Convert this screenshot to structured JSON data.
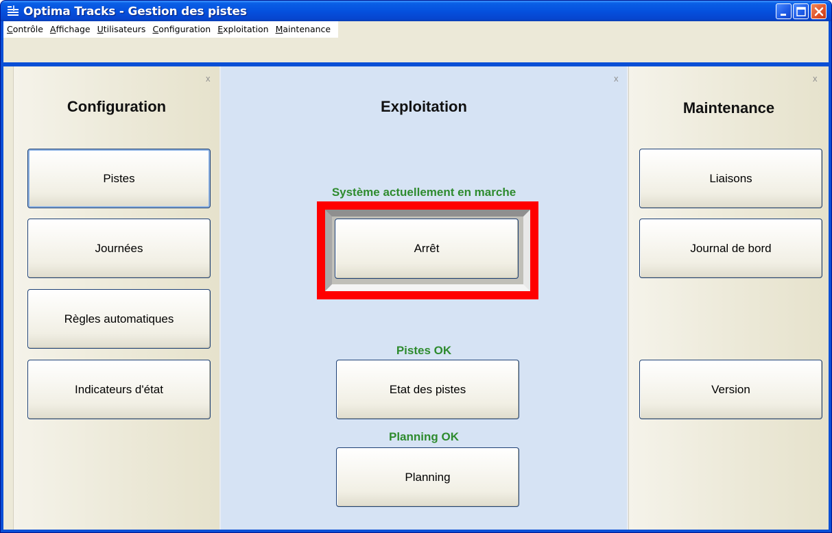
{
  "window": {
    "title": "Optima Tracks - Gestion des pistes"
  },
  "menu": {
    "items": [
      {
        "first": "C",
        "rest": "ontrôle"
      },
      {
        "first": "A",
        "rest": "ffichage"
      },
      {
        "first": "U",
        "rest": "tilisateurs"
      },
      {
        "first": "C",
        "rest": "onfiguration"
      },
      {
        "first": "E",
        "rest": "xploitation"
      },
      {
        "first": "M",
        "rest": "aintenance"
      }
    ]
  },
  "panels": {
    "configuration": {
      "title": "Configuration",
      "close": "x",
      "buttons": [
        "Pistes",
        "Journées",
        "Règles automatiques",
        "Indicateurs d'état"
      ]
    },
    "exploitation": {
      "title": "Exploitation",
      "close": "x",
      "system_status": "Système actuellement en marche",
      "stop_button": "Arrêt",
      "pistes_status": "Pistes OK",
      "pistes_button": "Etat des pistes",
      "planning_status": "Planning OK",
      "planning_button": "Planning"
    },
    "maintenance": {
      "title": "Maintenance",
      "close": "x",
      "buttons": [
        "Liaisons",
        "Journal de bord",
        "Version"
      ]
    }
  },
  "colors": {
    "status_ok": "#2e8b2e",
    "highlight": "#ff0000",
    "center_bg": "#d6e3f4",
    "titlebar": "#0551de"
  }
}
